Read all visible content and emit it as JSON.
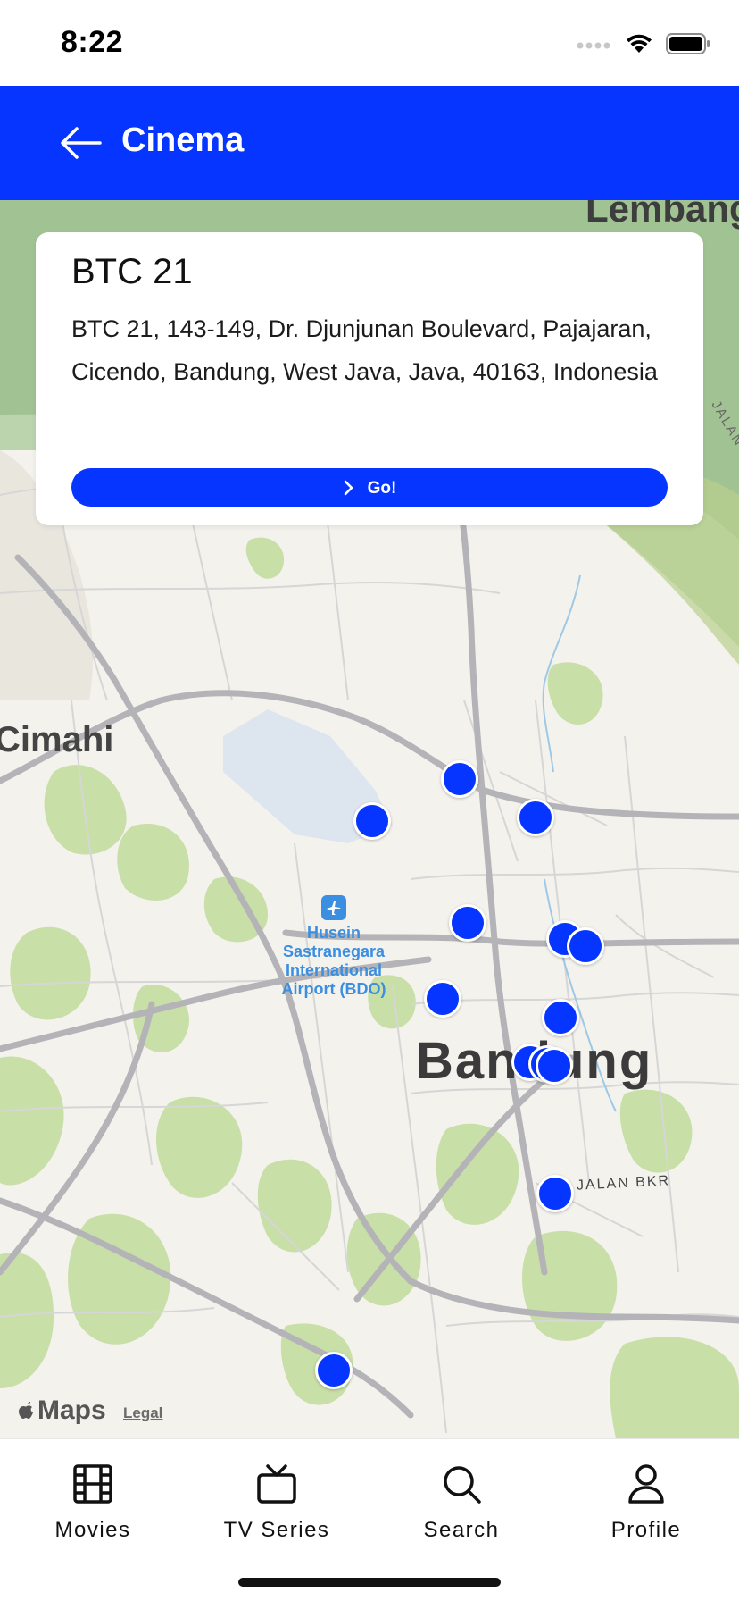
{
  "status_bar": {
    "time": "8:22",
    "icons": [
      "signal-icon",
      "wifi-icon",
      "battery-icon"
    ]
  },
  "header": {
    "title": "Cinema",
    "back_icon": "arrow-left-icon",
    "background_color": "#0535ff"
  },
  "card": {
    "title": "BTC 21",
    "address": "BTC 21, 143-149, Dr. Djunjunan Boulevard, Pajajaran, Cicendo, Bandung, West Java, Java, 40163, Indonesia",
    "button_label": "Go!",
    "button_icon": "chevron-right-icon"
  },
  "map": {
    "city_labels": {
      "cimahi": "Cimahi",
      "bandung": "Bandung",
      "lembang": "Lembang"
    },
    "road_labels": {
      "jalan_bkr": "JALAN BKR",
      "north_road": "JALAN D"
    },
    "airport": {
      "name": "Husein\nSastranegara\nInternational\nAirport (BDO)",
      "icon": "airplane-icon"
    },
    "pin_count": 13,
    "attribution": {
      "logo": "Maps",
      "legal": "Legal"
    }
  },
  "tab_bar": {
    "items": [
      {
        "label": "Movies",
        "icon": "film-icon"
      },
      {
        "label": "TV Series",
        "icon": "tv-icon"
      },
      {
        "label": "Search",
        "icon": "search-icon"
      },
      {
        "label": "Profile",
        "icon": "profile-icon"
      }
    ]
  }
}
